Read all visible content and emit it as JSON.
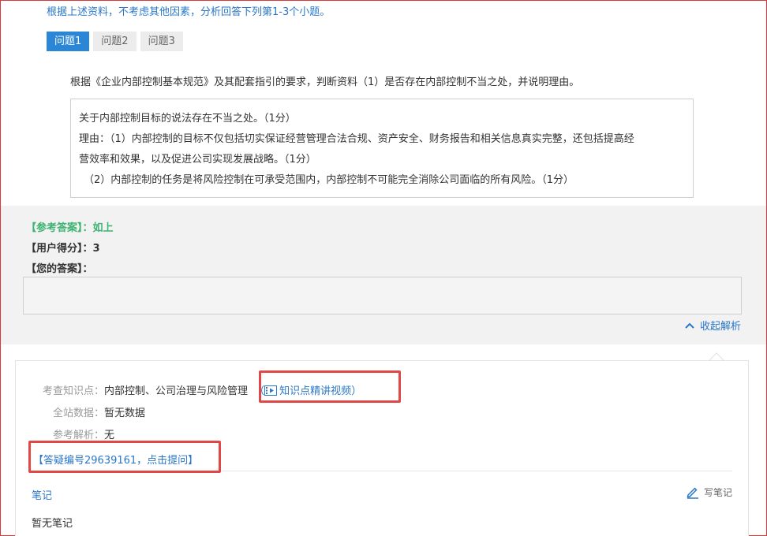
{
  "intro": "根据上述资料，不考虑其他因素，分析回答下列第1-3个小题。",
  "tabs": [
    {
      "label": "问题1",
      "active": true
    },
    {
      "label": "问题2",
      "active": false
    },
    {
      "label": "问题3",
      "active": false
    }
  ],
  "question": "根据《企业内部控制基本规范》及其配套指引的要求，判断资料（1）是否存在内部控制不当之处，并说明理由。",
  "answer_lines": [
    "关于内部控制目标的说法存在不当之处。（1分）",
    "理由：（1）内部控制的目标不仅包括切实保证经营管理合法合规、资产安全、财务报告和相关信息真实完整，还包括提高经",
    "营效率和效果，以及促进公司实现发展战略。（1分）",
    "（2）内部控制的任务是将风险控制在可承受范围内，内部控制不可能完全消除公司面临的所有风险。（1分）"
  ],
  "reference": {
    "label": "【参考答案】：",
    "value": "如上"
  },
  "user_score": {
    "label": "【用户得分】：",
    "value": "3"
  },
  "your_answer": {
    "label": "【您的答案】：",
    "value": ""
  },
  "collapse_label": "收起解析",
  "analysis": {
    "knowledge_label": "考查知识点：",
    "knowledge_value": "内部控制、公司治理与风险管理",
    "video_open": "（",
    "video_label": "知识点精讲视频",
    "video_close": "）",
    "site_label": "全站数据：",
    "site_value": "暂无数据",
    "ref_label": "参考解析：",
    "ref_value": "无",
    "qa_link": "【答疑编号29639161，点击提问】"
  },
  "notes": {
    "label": "笔记",
    "write_label": "写笔记",
    "empty": "暂无笔记"
  },
  "colors": {
    "accent": "#2a77c9",
    "tab_active": "#2b86d6",
    "reference_green": "#3cb371",
    "highlight_red": "#e04848"
  }
}
